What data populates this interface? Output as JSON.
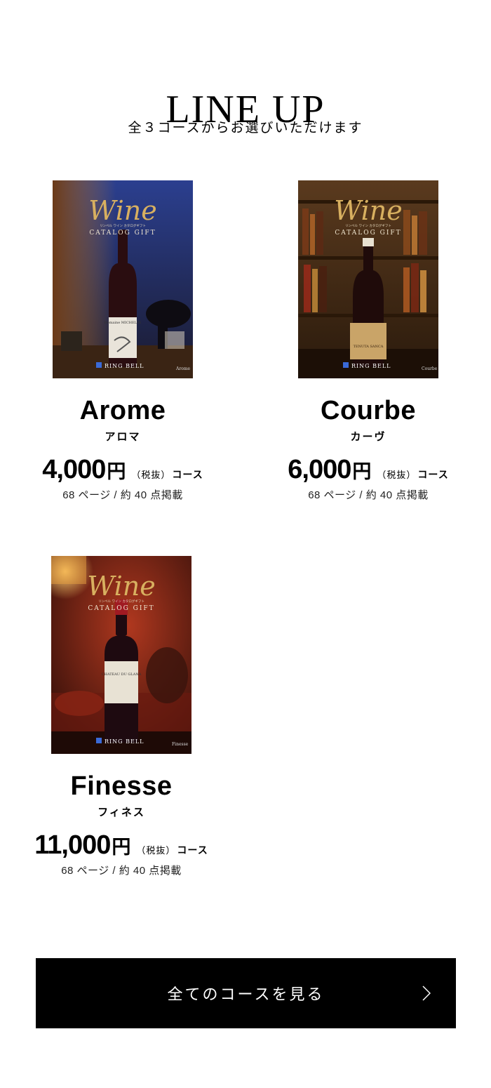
{
  "section": {
    "title": "LINE UP",
    "subtitle": "全３コースからお選びいただけます"
  },
  "products": [
    {
      "cover": {
        "script_title": "Wine",
        "catalog_label": "CATALOG GIFT",
        "kana_label": "リンベル ワイン カタログギフト",
        "bottle_label": "Domaine MICHELIN",
        "brand": "RING BELL",
        "corner_label": "Arome",
        "palette": {
          "bg_top": "#2b3f8f",
          "bg_bottom": "#1a1a2e",
          "accent": "#b8722b",
          "bottle": "#2a0d10"
        }
      },
      "name": "Arome",
      "kana": "アロマ",
      "price": "4,000",
      "yen": "円",
      "tax": "（税抜）",
      "course": "コース",
      "meta": "68 ページ / 約 40 点掲載"
    },
    {
      "cover": {
        "script_title": "Wine",
        "catalog_label": "CATALOG GIFT",
        "kana_label": "リンベル ワイン カタログギフト",
        "bottle_label": "TENUTA SANCA",
        "brand": "RING BELL",
        "corner_label": "Courbe",
        "palette": {
          "bg_top": "#5a3a1e",
          "bg_bottom": "#2a1a0c",
          "accent": "#c48a3c",
          "bottle": "#1f0b0a"
        }
      },
      "name": "Courbe",
      "kana": "カーヴ",
      "price": "6,000",
      "yen": "円",
      "tax": "（税抜）",
      "course": "コース",
      "meta": "68 ページ / 約 40 点掲載"
    },
    {
      "cover": {
        "script_title": "Wine",
        "catalog_label": "CATALOG GIFT",
        "kana_label": "リンベル ワイン カタログギフト",
        "bottle_label": "CHATEAU DU GLANA",
        "brand": "RING BELL",
        "corner_label": "Finesse",
        "palette": {
          "bg_top": "#b0381f",
          "bg_bottom": "#2a0c08",
          "accent": "#e0a040",
          "bottle": "#1e0a10"
        }
      },
      "name": "Finesse",
      "kana": "フィネス",
      "price": "11,000",
      "yen": "円",
      "tax": "（税抜）",
      "course": "コース",
      "meta": "68 ページ / 約 40 点掲載"
    }
  ],
  "cta": {
    "label": "全てのコースを見る",
    "icon": "chevron-right-icon"
  }
}
